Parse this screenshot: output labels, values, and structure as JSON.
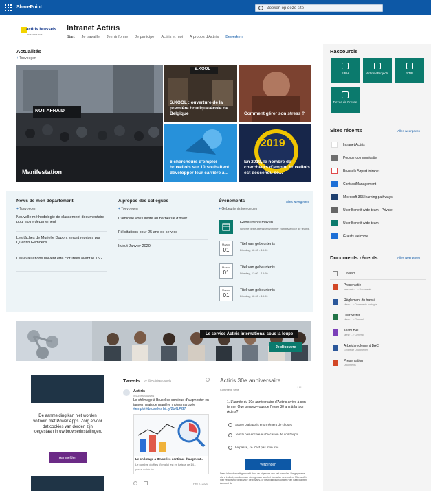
{
  "topbar": {
    "brand": "SharePoint",
    "search_placeholder": "Zoeken op deze site"
  },
  "site": {
    "logo_text": "actiris.brussels",
    "logo_tagline": "werk.travail.work",
    "title": "Intranet Actiris",
    "nav": [
      "Start",
      "Je travaille",
      "Je m'informe",
      "Je participe",
      "Actiris et moi",
      "A propos d'Actiris",
      "Bewerken"
    ]
  },
  "news": {
    "title": "Actualités",
    "add_label": "Toevoegen",
    "items": [
      "Manifestation",
      "S.KOOL : ouverture de la première boutique-école de Belgique",
      "Comment gérer son stress ?",
      "6 chercheurs d'emploi bruxellois sur 10 souhaitent développer leur carrière à...",
      "En 2019, le nombre de chercheurs d'emploi bruxellois est descendu so..."
    ],
    "sign_not_afraid": "NOT AFRAID",
    "sign_skool": "S.KOOL",
    "year_2019": "2019"
  },
  "dept": {
    "title": "News de mon département",
    "add_label": "Toevoegen",
    "items": [
      "Nouvelle méthodologie de classement documentaire pour notre département",
      "Les tâches de Murielle Dupont seront reprises par Quentin Gemoeds",
      "Les évaluations doivent être clôturées avant le 15/2"
    ]
  },
  "colleagues": {
    "title": "A propos des collègues",
    "add_label": "Toevoegen",
    "items": [
      "L'amicale vous invite au barbecue d'hiver",
      "Félicitations pour 25 ans de service",
      "In/out Janvier 2020"
    ]
  },
  "events": {
    "title": "Événements",
    "see_all": "Alles weergeven",
    "add_label": "Gebeurtenis toevoegen",
    "make": {
      "title": "Gebeurtenis maken",
      "desc": "Nieuwe gebeurtenissen zijn hier zichtbaar voor de teams."
    },
    "items": [
      {
        "month": "Maand",
        "day": "01",
        "title": "Titel van gebeurtenis",
        "time": "Dinsdag, 12:00 - 13:00"
      },
      {
        "month": "Maand",
        "day": "01",
        "title": "Titel van gebeurtenis",
        "time": "Dinsdag, 12:00 - 13:00"
      },
      {
        "month": "Maand",
        "day": "01",
        "title": "Titel van gebeurtenis",
        "time": "Dinsdag, 12:00 - 13:00"
      }
    ]
  },
  "banner": {
    "label": "Le service Actiris international sous la loupe",
    "button": "Je découvre"
  },
  "powerapps": {
    "message": "De aanmelding kan niet worden voltooid met Power Apps. Zorg ervoor dat cookies van derden zijn toegestaan in uw browserinstellingen.",
    "button": "Aanmelden"
  },
  "tweets": {
    "title": "Tweets",
    "by": "by @ActirisBrussels",
    "account": "Actiris",
    "handle": "@ActirisBrussels",
    "text": "Le chômage à Bruxelles continue d'augmenter en janvier, mais de manière moins marquée",
    "hashtags": "#emploi #bruxelles bit.ly/2bKLPG7",
    "card_title": "Le chômage à Bruxelles continue d'augment...",
    "card_desc": "Le nombre d'offres d'emploi est en baisse de 14...",
    "card_domain": "press.actiris.be",
    "date": "Feb 2, 2020"
  },
  "poll": {
    "title": "Actiris 30e anniversaire",
    "subtitle": "Comme le sens",
    "question": "1. L'année du 30e anniversaire d'Actiris arrive à son terme. Que pensez-vous de l'expo 30 ans à la tour Actiris?",
    "options": [
      "Super! J'ai appris énormément de choses",
      "Je n'ai pas encore eu l'occasion de voir l'expo",
      "Le passé, ce n'est pas mon truc"
    ],
    "submit": "Verzenden",
    "footer": "Deze inhoud wordt gemaakt door de eigenaar van het formulier. De gegevens die u indient, worden naar de eigenaar van het formulier verzonden. Microsoft is niet verantwoordelijk voor de privacy- of beveiligingspraktijken van haar klanten. Account de"
  },
  "quicklinks": {
    "title": "Raccourcis",
    "tiles": [
      "SIRH",
      "Actiris eProjects",
      "STIB",
      "Revue de Presse"
    ]
  },
  "recent_sites": {
    "title": "Sites récents",
    "see_all": "Alles weergeven",
    "items": [
      "Intranet Actiris",
      "Pouvoir communicatie",
      "Brussels Airport intranet",
      "ContractManagement",
      "Microsoft 365 learning pathways",
      "User Benefit wide team - Private",
      "User Benefit wide team",
      "Guests welcome"
    ]
  },
  "recent_docs": {
    "title": "Documents récents",
    "see_all": "Alles weergeven",
    "header": "Naam",
    "items": [
      {
        "name": "Presentatie",
        "sub": "personal › ... › Documents"
      },
      {
        "name": "Règlement du travail",
        "sub": "sites › ... › Documents partagés"
      },
      {
        "name": "Uurrooster",
        "sub": "sites › ... › General"
      },
      {
        "name": "Team BAC",
        "sub": "sites › ... › General"
      },
      {
        "name": "Arbeidsreglement BAC",
        "sub": "Gedeelde Documenten"
      },
      {
        "name": "Presentation",
        "sub": "Documents"
      }
    ]
  },
  "colors": {
    "brand": "#0d58a6",
    "teal": "#0b7a6d",
    "band": "#edf4f7",
    "rail": "#f4f4f4"
  }
}
